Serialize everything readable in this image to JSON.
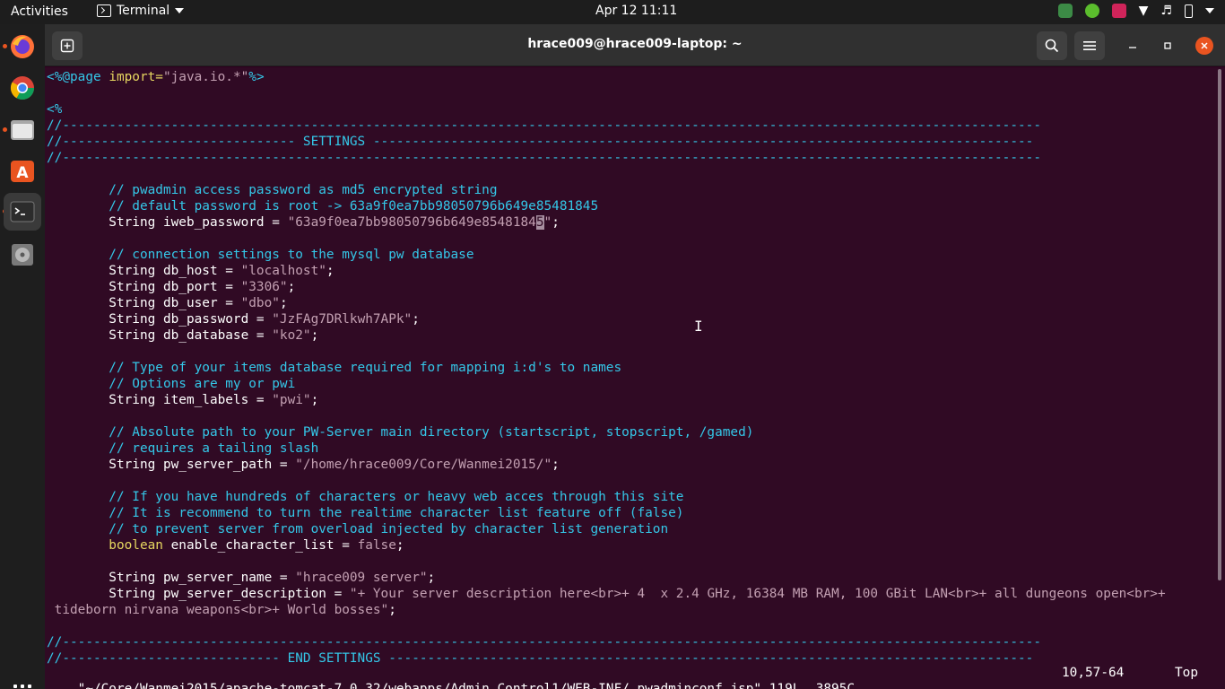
{
  "topbar": {
    "activities": "Activities",
    "app_name": "Terminal",
    "clock": "Apr 12  11:11"
  },
  "window": {
    "title": "hrace009@hrace009-laptop: ~"
  },
  "editor": {
    "lines": [
      {
        "segments": [
          {
            "t": "<%@page ",
            "c": "c-tag"
          },
          {
            "t": "import=",
            "c": "c-type"
          },
          {
            "t": "\"java.io.*\"",
            "c": "c-string"
          },
          {
            "t": "%>",
            "c": "c-tag"
          }
        ]
      },
      {
        "segments": []
      },
      {
        "segments": [
          {
            "t": "<%",
            "c": "c-tag"
          }
        ]
      },
      {
        "segments": [
          {
            "t": "//------------------------------------------------------------------------------------------------------------------------------",
            "c": "c-comment"
          }
        ]
      },
      {
        "segments": [
          {
            "t": "//------------------------------ SETTINGS -------------------------------------------------------------------------------------",
            "c": "c-comment"
          }
        ]
      },
      {
        "segments": [
          {
            "t": "//------------------------------------------------------------------------------------------------------------------------------",
            "c": "c-comment"
          }
        ]
      },
      {
        "segments": []
      },
      {
        "segments": [
          {
            "t": "        // pwadmin access password as md5 encrypted string",
            "c": "c-comment"
          }
        ]
      },
      {
        "segments": [
          {
            "t": "        // default password is root -> 63a9f0ea7bb98050796b649e85481845",
            "c": "c-comment"
          }
        ]
      },
      {
        "segments": [
          {
            "t": "        String iweb_password = ",
            "c": ""
          },
          {
            "t": "\"63a9f0ea7bb98050796b649e8548184",
            "c": "c-string"
          },
          {
            "t": "5",
            "c": "c-cursor"
          },
          {
            "t": "\"",
            "c": "c-string"
          },
          {
            "t": ";",
            "c": ""
          }
        ]
      },
      {
        "segments": []
      },
      {
        "segments": [
          {
            "t": "        // connection settings to the mysql pw database",
            "c": "c-comment"
          }
        ]
      },
      {
        "segments": [
          {
            "t": "        String db_host = ",
            "c": ""
          },
          {
            "t": "\"localhost\"",
            "c": "c-string"
          },
          {
            "t": ";",
            "c": ""
          }
        ]
      },
      {
        "segments": [
          {
            "t": "        String db_port = ",
            "c": ""
          },
          {
            "t": "\"3306\"",
            "c": "c-string"
          },
          {
            "t": ";",
            "c": ""
          }
        ]
      },
      {
        "segments": [
          {
            "t": "        String db_user = ",
            "c": ""
          },
          {
            "t": "\"dbo\"",
            "c": "c-string"
          },
          {
            "t": ";",
            "c": ""
          }
        ]
      },
      {
        "segments": [
          {
            "t": "        String db_password = ",
            "c": ""
          },
          {
            "t": "\"JzFAg7DRlkwh7APk\"",
            "c": "c-string"
          },
          {
            "t": ";",
            "c": ""
          }
        ]
      },
      {
        "segments": [
          {
            "t": "        String db_database = ",
            "c": ""
          },
          {
            "t": "\"ko2\"",
            "c": "c-string"
          },
          {
            "t": ";",
            "c": ""
          }
        ]
      },
      {
        "segments": []
      },
      {
        "segments": [
          {
            "t": "        // Type of your items database required for mapping i:d's to names",
            "c": "c-comment"
          }
        ]
      },
      {
        "segments": [
          {
            "t": "        // Options are my or pwi",
            "c": "c-comment"
          }
        ]
      },
      {
        "segments": [
          {
            "t": "        String item_labels = ",
            "c": ""
          },
          {
            "t": "\"pwi\"",
            "c": "c-string"
          },
          {
            "t": ";",
            "c": ""
          }
        ]
      },
      {
        "segments": []
      },
      {
        "segments": [
          {
            "t": "        // Absolute path to your PW-Server main directory (startscript, stopscript, /gamed)",
            "c": "c-comment"
          }
        ]
      },
      {
        "segments": [
          {
            "t": "        // requires a tailing slash",
            "c": "c-comment"
          }
        ]
      },
      {
        "segments": [
          {
            "t": "        String pw_server_path = ",
            "c": ""
          },
          {
            "t": "\"/home/hrace009/Core/Wanmei2015/\"",
            "c": "c-string"
          },
          {
            "t": ";",
            "c": ""
          }
        ]
      },
      {
        "segments": []
      },
      {
        "segments": [
          {
            "t": "        // If you have hundreds of characters or heavy web acces through this site",
            "c": "c-comment"
          }
        ]
      },
      {
        "segments": [
          {
            "t": "        // It is recommend to turn the realtime character list feature off (false)",
            "c": "c-comment"
          }
        ]
      },
      {
        "segments": [
          {
            "t": "        // to prevent server from overload injected by character list generation",
            "c": "c-comment"
          }
        ]
      },
      {
        "segments": [
          {
            "t": "        boolean ",
            "c": "c-type"
          },
          {
            "t": "enable_character_list = ",
            "c": ""
          },
          {
            "t": "false",
            "c": "c-string"
          },
          {
            "t": ";",
            "c": ""
          }
        ]
      },
      {
        "segments": []
      },
      {
        "segments": [
          {
            "t": "        String pw_server_name = ",
            "c": ""
          },
          {
            "t": "\"hrace009 server\"",
            "c": "c-string"
          },
          {
            "t": ";",
            "c": ""
          }
        ]
      },
      {
        "segments": [
          {
            "t": "        String pw_server_description = ",
            "c": ""
          },
          {
            "t": "\"+ Your server description here<br>+ 4  x 2.4 GHz, 16384 MB RAM, 100 GBit LAN<br>+ all dungeons open<br>+",
            "c": "c-string"
          }
        ]
      },
      {
        "segments": [
          {
            "t": " tideborn nirvana weapons<br>+ World bosses\"",
            "c": "c-string"
          },
          {
            "t": ";",
            "c": ""
          }
        ]
      },
      {
        "segments": []
      },
      {
        "segments": [
          {
            "t": "//------------------------------------------------------------------------------------------------------------------------------",
            "c": "c-comment"
          }
        ]
      },
      {
        "segments": [
          {
            "t": "//---------------------------- END SETTINGS -----------------------------------------------------------------------------------",
            "c": "c-comment"
          }
        ]
      }
    ],
    "status_file": "\"~/Core/Wanmei2015/apache-tomcat-7.0.32/webapps/Admin_Control1/WEB-INF/.pwadminconf.jsp\" 119L, 3895C",
    "status_pos": "10,57-64",
    "status_scroll": "Top",
    "ibeam": "I"
  }
}
